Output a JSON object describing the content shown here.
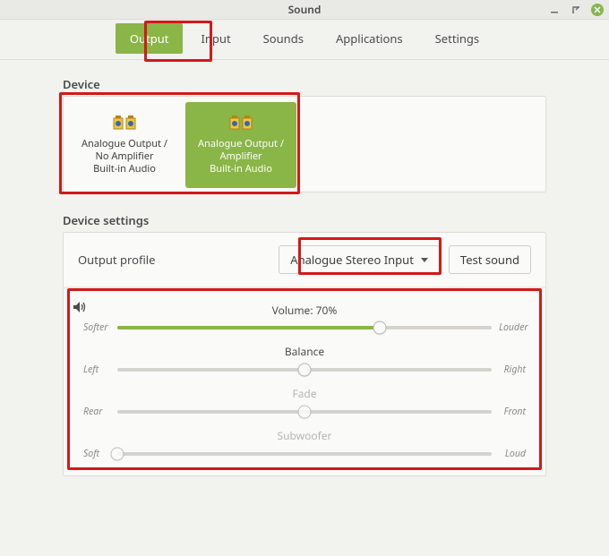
{
  "window": {
    "title": "Sound"
  },
  "tabs": [
    {
      "label": "Output",
      "active": true
    },
    {
      "label": "Input",
      "active": false
    },
    {
      "label": "Sounds",
      "active": false
    },
    {
      "label": "Applications",
      "active": false
    },
    {
      "label": "Settings",
      "active": false
    }
  ],
  "sections": {
    "device_label": "Device",
    "settings_label": "Device settings"
  },
  "devices": [
    {
      "line1": "Analogue Output /",
      "line2": "No Amplifier",
      "line3": "Built-in Audio",
      "selected": false
    },
    {
      "line1": "Analogue Output /",
      "line2": "Amplifier",
      "line3": "Built-in Audio",
      "selected": true
    }
  ],
  "profile": {
    "label": "Output profile",
    "selected": "Analogue Stereo Input",
    "test_button": "Test sound"
  },
  "sliders": {
    "volume": {
      "title": "Volume: 70%",
      "left": "Softer",
      "right": "Louder",
      "value": 0.7,
      "fill": true,
      "enabled": true
    },
    "balance": {
      "title": "Balance",
      "left": "Left",
      "right": "Right",
      "value": 0.5,
      "fill": false,
      "enabled": true
    },
    "fade": {
      "title": "Fade",
      "left": "Rear",
      "right": "Front",
      "value": 0.5,
      "fill": false,
      "enabled": false
    },
    "subwoofer": {
      "title": "Subwoofer",
      "left": "Soft",
      "right": "Loud",
      "value": 0.0,
      "fill": false,
      "enabled": false
    }
  }
}
